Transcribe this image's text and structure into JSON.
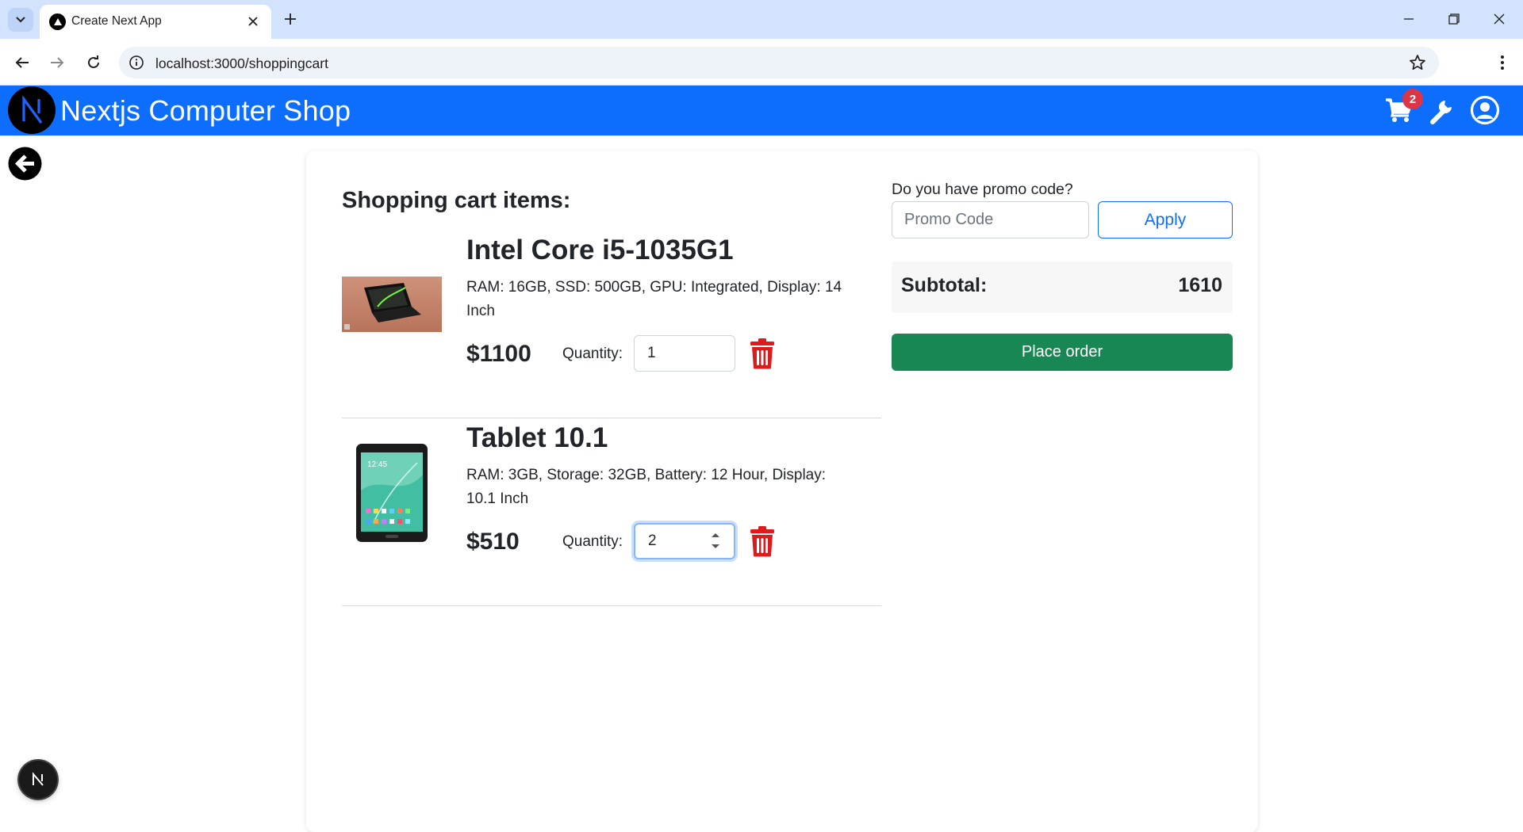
{
  "browser": {
    "tab_title": "Create Next App",
    "url": "localhost:3000/shoppingcart"
  },
  "navbar": {
    "brand": "Nextjs Computer Shop",
    "logo_letter": "N",
    "cart_count": "2",
    "color": "#0d6efd"
  },
  "cart": {
    "title": "Shopping cart items:",
    "items": [
      {
        "name": "Intel Core i5-1035G1",
        "description": "RAM: 16GB, SSD: 500GB, GPU: Integrated, Display: 14 Inch",
        "price": "$1100",
        "quantity_label": "Quantity:",
        "quantity": "1"
      },
      {
        "name": "Tablet 10.1",
        "description": "RAM: 3GB, Storage: 32GB, Battery: 12 Hour, Display: 10.1 Inch",
        "price": "$510",
        "quantity_label": "Quantity:",
        "quantity": "2"
      }
    ]
  },
  "summary": {
    "promo_label": "Do you have promo code?",
    "promo_placeholder": "Promo Code",
    "apply_label": "Apply",
    "subtotal_label": "Subtotal:",
    "subtotal_value": "1610",
    "order_label": "Place order",
    "order_color": "#198754",
    "delete_color": "#dc1c1c"
  },
  "dev_badge": {
    "letter": "N"
  }
}
